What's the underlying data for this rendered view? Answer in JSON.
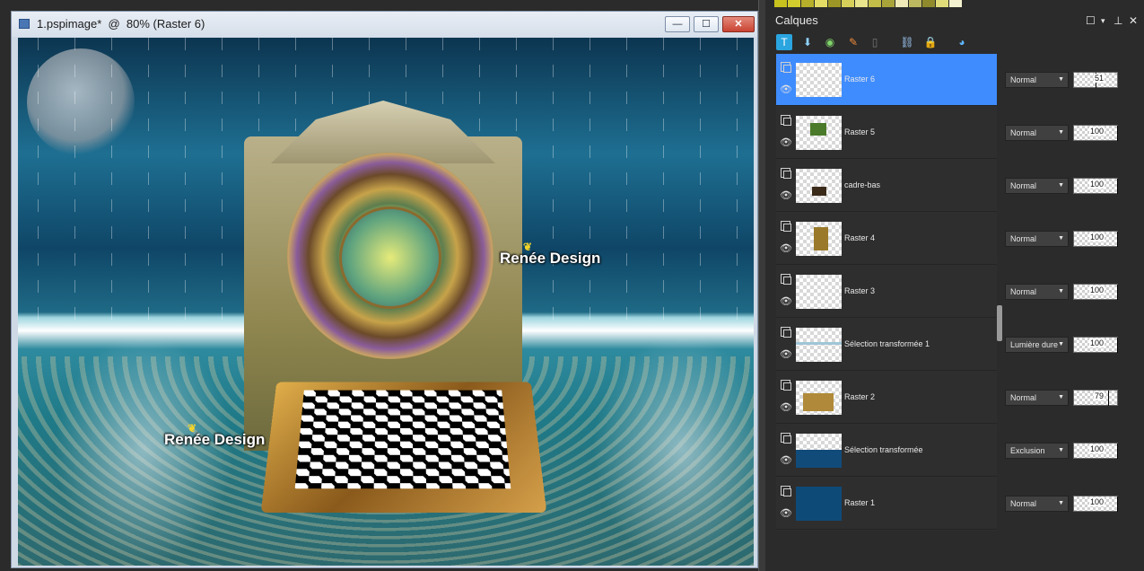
{
  "window": {
    "title": "1.pspimage*  @  80% (Raster 6)",
    "min_label": "—",
    "max_label": "☐",
    "close_label": "✕"
  },
  "watermarks": [
    "Renée Design",
    "Renée Design"
  ],
  "panel": {
    "title": "Calques",
    "swatch_colors": [
      "#c8c21e",
      "#d2cc2e",
      "#b6b02a",
      "#e3dd66",
      "#9c9626",
      "#d6d05a",
      "#e9e58d",
      "#c2bd48",
      "#a9a43a",
      "#efeab8",
      "#bcb862",
      "#8f8b2c",
      "#e0dc7a",
      "#f3f1cf"
    ]
  },
  "layers": [
    {
      "name": "Raster 6",
      "blend": "Normal",
      "opacity": 51,
      "selected": true
    },
    {
      "name": "Raster 5",
      "blend": "Normal",
      "opacity": 100,
      "selected": false
    },
    {
      "name": "cadre-bas",
      "blend": "Normal",
      "opacity": 100,
      "selected": false
    },
    {
      "name": "Raster 4",
      "blend": "Normal",
      "opacity": 100,
      "selected": false
    },
    {
      "name": "Raster 3",
      "blend": "Normal",
      "opacity": 100,
      "selected": false
    },
    {
      "name": "Sélection transformée 1",
      "blend": "Lumière dure",
      "opacity": 100,
      "selected": false
    },
    {
      "name": "Raster 2",
      "blend": "Normal",
      "opacity": 79,
      "selected": false
    },
    {
      "name": "Sélection transformée",
      "blend": "Exclusion",
      "opacity": 100,
      "selected": false
    },
    {
      "name": "Raster 1",
      "blend": "Normal",
      "opacity": 100,
      "selected": false
    }
  ],
  "colors": {
    "selection": "#3f8cff",
    "panel_bg": "#2b2b2b"
  }
}
